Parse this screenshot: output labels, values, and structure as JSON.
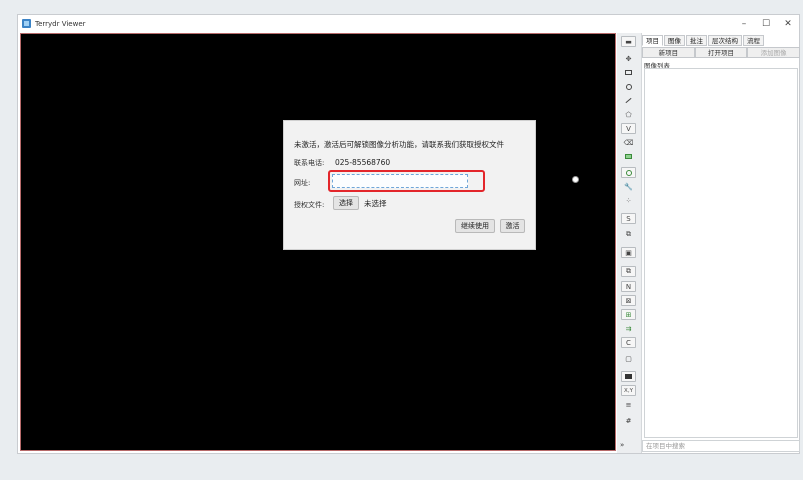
{
  "window": {
    "title": "Terrydr Viewer",
    "controls": {
      "minimize": "–",
      "maximize": "☐",
      "close": "✕"
    }
  },
  "dialog": {
    "message": "未激活，激活后可解锁图像分析功能，请联系我们获取授权文件",
    "phone_label": "联系电话:",
    "phone_value": "025-85568760",
    "url_label": "网址:",
    "url_value": "",
    "file_label": "授权文件:",
    "choose_button": "选择",
    "file_status": "未选择",
    "continue_button": "继续使用",
    "activate_button": "激活"
  },
  "toolbar": {
    "tools": [
      {
        "name": "select-tool",
        "glyph": "▬"
      },
      {
        "name": "move-tool",
        "glyph": "✥"
      },
      {
        "name": "rectangle-tool",
        "glyph": ""
      },
      {
        "name": "ellipse-tool",
        "glyph": ""
      },
      {
        "name": "line-tool",
        "glyph": ""
      },
      {
        "name": "polygon-tool",
        "glyph": "⬠"
      },
      {
        "name": "v-tool",
        "glyph": "V"
      },
      {
        "name": "eraser-tool",
        "glyph": "⌫"
      },
      {
        "name": "fill-rect-tool",
        "glyph": ""
      },
      {
        "name": "target-tool",
        "glyph": ""
      },
      {
        "name": "wrench-tool",
        "glyph": "🔧"
      },
      {
        "name": "points-tool",
        "glyph": "⁘"
      },
      {
        "name": "s-tool",
        "glyph": "S"
      },
      {
        "name": "link-tool",
        "glyph": "⧉"
      },
      {
        "name": "frame-tool",
        "glyph": "▣"
      },
      {
        "name": "copy-tool",
        "glyph": "⧉"
      },
      {
        "name": "n-tool",
        "glyph": "N"
      },
      {
        "name": "grid-tool",
        "glyph": "⊠"
      },
      {
        "name": "green-grid-tool",
        "glyph": "⊞"
      },
      {
        "name": "green-arrow-tool",
        "glyph": "⇉"
      },
      {
        "name": "c-tool",
        "glyph": "C"
      },
      {
        "name": "window-tool",
        "glyph": "▢"
      },
      {
        "name": "black-rect-tool",
        "glyph": ""
      },
      {
        "name": "xy-tool",
        "glyph": "X,Y"
      },
      {
        "name": "list-tool",
        "glyph": "≡"
      },
      {
        "name": "hash-tool",
        "glyph": "#"
      }
    ],
    "expand_glyph": "»"
  },
  "right_panel": {
    "tabs": [
      "项目",
      "图像",
      "批注",
      "层次结构",
      "流程"
    ],
    "buttons": [
      "新项目",
      "打开项目",
      "添加图像"
    ],
    "list_label": "图像列表",
    "search_placeholder": "在项目中搜索"
  }
}
